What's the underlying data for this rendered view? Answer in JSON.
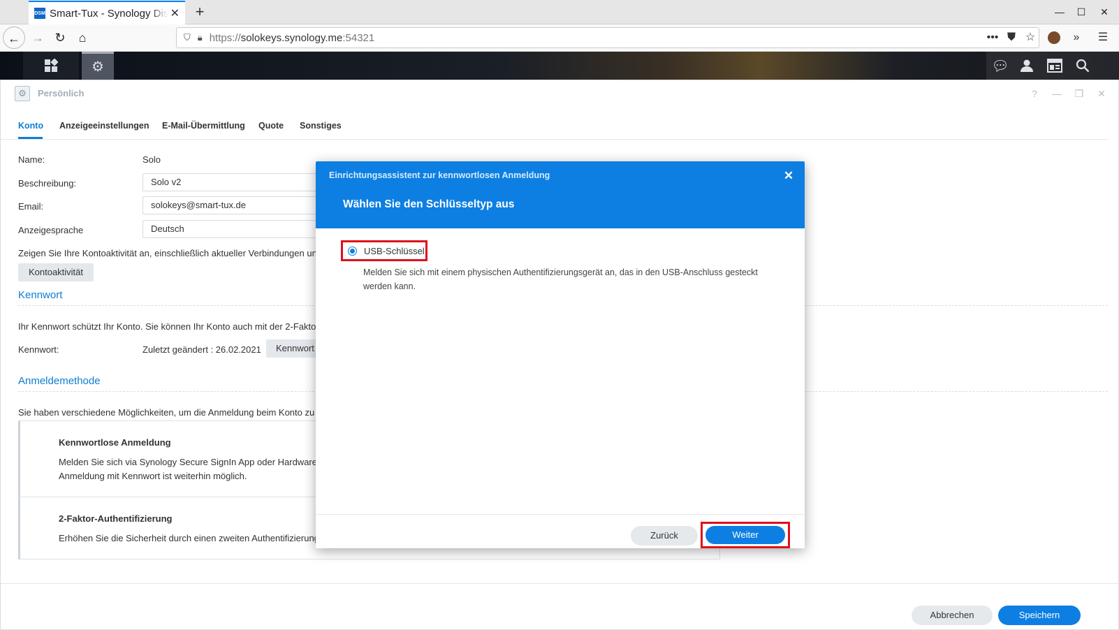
{
  "browser": {
    "tab_title": "Smart-Tux - Synology DiskStation",
    "favicon_text": "DSM",
    "url_prefix": "https://",
    "url_host": "solokeys.synology.me",
    "url_port": ":54321"
  },
  "window": {
    "title": "Persönlich",
    "tabs": [
      "Konto",
      "Anzeigeeinstellungen",
      "E-Mail-Übermittlung",
      "Quote",
      "Sonstiges"
    ]
  },
  "account": {
    "name_label": "Name:",
    "name_value": "Solo",
    "desc_label": "Beschreibung:",
    "desc_value": "Solo v2",
    "email_label": "Email:",
    "email_value": "solokeys@smart-tux.de",
    "lang_label": "Anzeigesprache",
    "lang_value": "Deutsch",
    "activity_text": "Zeigen Sie Ihre Kontoaktivität an, einschließlich aktueller Verbindungen un",
    "activity_button": "Kontoaktivität"
  },
  "password": {
    "section": "Kennwort",
    "text": "Ihr Kennwort schützt Ihr Konto. Sie können Ihr Konto auch mit der 2-Fakto",
    "label": "Kennwort:",
    "changed": "Zuletzt geändert : 26.02.2021",
    "button": "Kennwort"
  },
  "login_method": {
    "section": "Anmeldemethode",
    "text": "Sie haben verschiedene Möglichkeiten, um die Anmeldung beim Konto zu",
    "card1_title": "Kennwortlose Anmeldung",
    "card1_line1": "Melden Sie sich via Synology Secure SignIn App oder Hardware",
    "card1_line2": "Anmeldung mit Kennwort ist weiterhin möglich.",
    "card2_title": "2-Faktor-Authentifizierung",
    "card2_line1": "Erhöhen Sie die Sicherheit durch einen zweiten Authentifizierungsschritt."
  },
  "footer": {
    "cancel": "Abbrechen",
    "save": "Speichern"
  },
  "modal": {
    "subtitle": "Einrichtungsassistent zur kennwortlosen Anmeldung",
    "title": "Wählen Sie den Schlüsseltyp aus",
    "option_label": "USB-Schlüssel",
    "option_desc": "Melden Sie sich mit einem physischen Authentifizierungsgerät an, das in den USB-Anschluss gesteckt werden kann.",
    "back": "Zurück",
    "next": "Weiter"
  }
}
